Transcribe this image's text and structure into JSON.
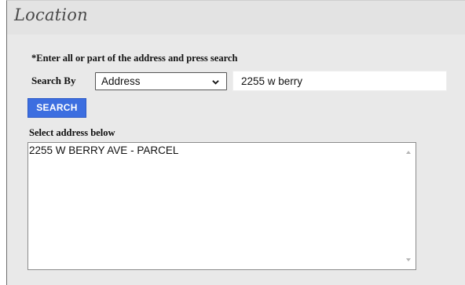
{
  "panel": {
    "title": "Location"
  },
  "form": {
    "instruction": "*Enter all or part of the address and press search",
    "search_by_label": "Search By",
    "search_by_selected": "Address",
    "search_input_value": "2255 w berry",
    "search_button_label": "SEARCH"
  },
  "results": {
    "label": "Select address below",
    "items": [
      "2255 W BERRY AVE - PARCEL"
    ]
  },
  "icons": {
    "select_arrow": "chevron-down-icon",
    "scroll_up": "scroll-up-arrow-icon",
    "scroll_down": "scroll-down-arrow-icon"
  },
  "colors": {
    "panel_background": "#e9e9e9",
    "title_bar": "#e3e3e3",
    "search_button": "#3c6ee0"
  }
}
